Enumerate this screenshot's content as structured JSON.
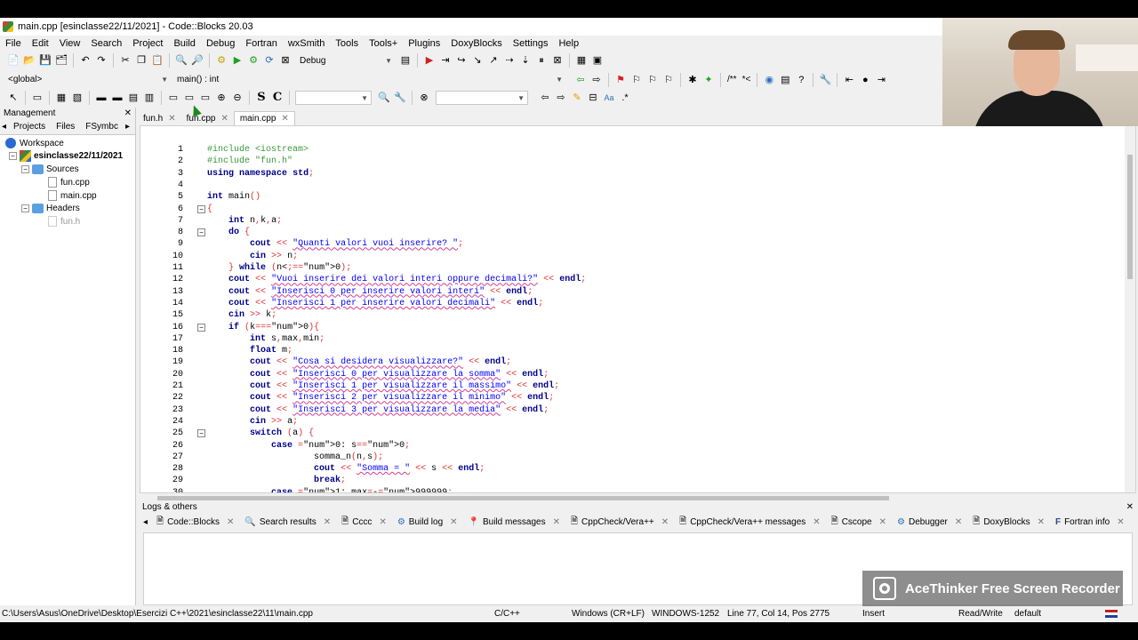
{
  "window": {
    "title": "main.cpp [esinclasse22/11/2021] - Code::Blocks 20.03"
  },
  "menu": [
    "File",
    "Edit",
    "View",
    "Search",
    "Project",
    "Build",
    "Debug",
    "Fortran",
    "wxSmith",
    "Tools",
    "Tools+",
    "Plugins",
    "DoxyBlocks",
    "Settings",
    "Help"
  ],
  "toolbar": {
    "build_target": "Debug",
    "scope": "<global>",
    "function": "main() : int",
    "comment_btn": "/**",
    "comment_btn2": "*<"
  },
  "toolbar3": {
    "s_btn": "S",
    "c_btn": "C",
    "search_text": ""
  },
  "management": {
    "title": "Management",
    "tabs": [
      "Projects",
      "Files",
      "FSymbc"
    ],
    "workspace": "Workspace",
    "project": "esinclasse22/11/2021",
    "sources": "Sources",
    "source_files": [
      "fun.cpp",
      "main.cpp"
    ],
    "headers": "Headers",
    "header_files": [
      "fun.h"
    ]
  },
  "editor_tabs": [
    "fun.h",
    "fun.cpp",
    "main.cpp"
  ],
  "code_lines": [
    "#include <iostream>",
    "#include \"fun.h\"",
    "using namespace std;",
    "",
    "int main()",
    "{",
    "    int n,k,a;",
    "    do {",
    "        cout << \"Quanti valori vuoi inserire? \";",
    "        cin >> n;",
    "    } while (n<=0);",
    "    cout << \"Vuoi inserire dei valori interi oppure decimali?\" << endl;",
    "    cout << \"Inserisci 0 per inserire valori interi\" << endl;",
    "    cout << \"Inserisci 1 per inserire valori decimali\" << endl;",
    "    cin >> k;",
    "    if (k==0){",
    "        int s,max,min;",
    "        float m;",
    "        cout << \"Cosa si desidera visualizzare?\" << endl;",
    "        cout << \"Inserisci 0 per visualizzare la somma\" << endl;",
    "        cout << \"Inserisci 1 per visualizzare il massimo\" << endl;",
    "        cout << \"Inserisci 2 per visualizzare il minimo\" << endl;",
    "        cout << \"Inserisci 3 per visualizzare la media\" << endl;",
    "        cin >> a;",
    "        switch (a) {",
    "            case 0: s=0;",
    "                    somma_n(n,s);",
    "                    cout << \"Somma = \" << s << endl;",
    "                    break;",
    "            case 1: max=-999999;"
  ],
  "logs": {
    "title": "Logs & others",
    "tabs": [
      "Code::Blocks",
      "Search results",
      "Cccc",
      "Build log",
      "Build messages",
      "CppCheck/Vera++",
      "CppCheck/Vera++ messages",
      "Cscope",
      "Debugger",
      "DoxyBlocks",
      "Fortran info"
    ]
  },
  "status": {
    "path": "C:\\Users\\Asus\\OneDrive\\Desktop\\Esercizi C++\\2021\\esinclasse22\\11\\main.cpp",
    "lang": "C/C++",
    "eol": "Windows (CR+LF)",
    "encoding": "WINDOWS-1252",
    "position": "Line 77, Col 14, Pos 2775",
    "mode": "Insert",
    "access": "Read/Write",
    "profile": "default"
  },
  "watermark": "AceThinker Free Screen Recorder"
}
